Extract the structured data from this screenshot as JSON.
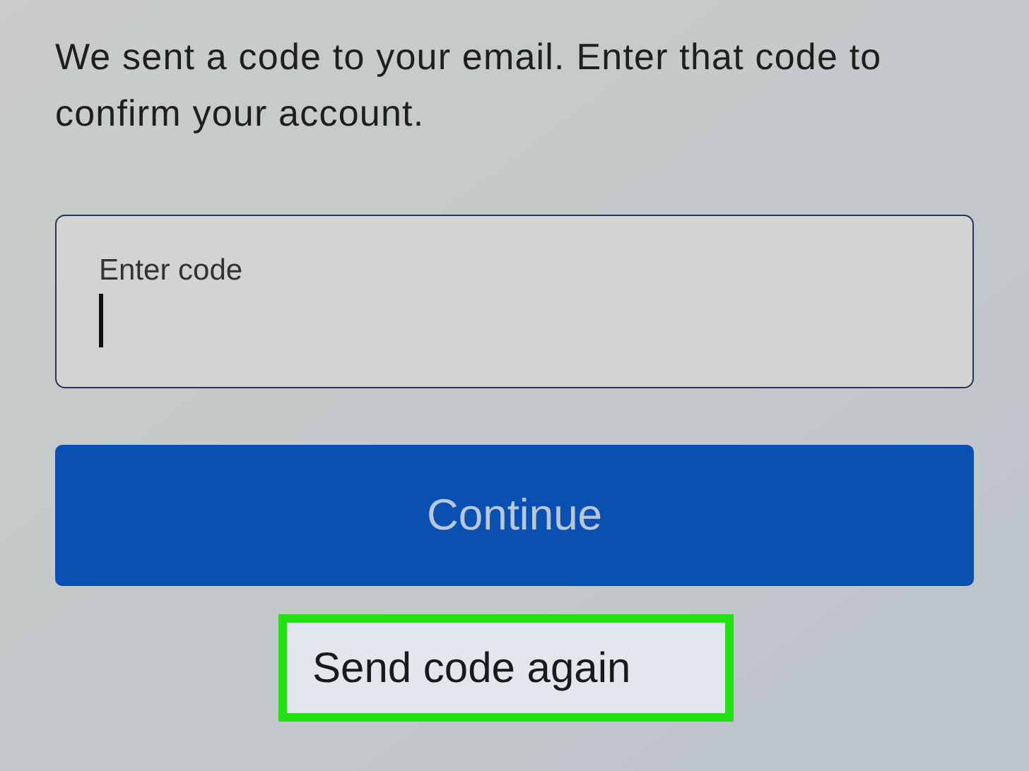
{
  "message": "We sent a code to your email. Enter that code to confirm your account.",
  "code_field": {
    "placeholder": "Enter code",
    "focused": true
  },
  "continue_button": {
    "label": "Continue"
  },
  "resend_button": {
    "label": "Send code again",
    "highlighted": true
  }
}
